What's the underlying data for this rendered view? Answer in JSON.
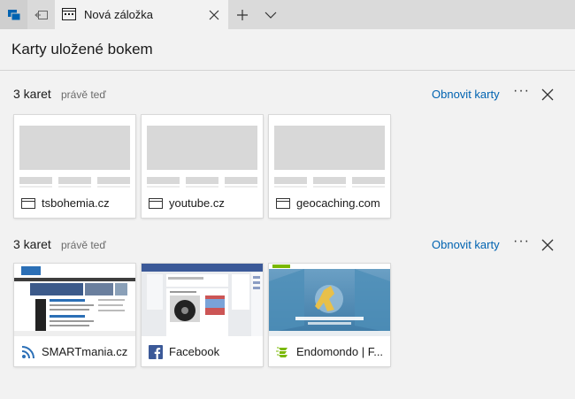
{
  "tab": {
    "title": "Nová záložka"
  },
  "pane": {
    "title": "Karty uložené bokem"
  },
  "groups": [
    {
      "count": "3 karet",
      "time": "právě teď",
      "restore_label": "Obnovit karty",
      "more_label": "···",
      "tabs": [
        {
          "label": "tsbohemia.cz"
        },
        {
          "label": "youtube.cz"
        },
        {
          "label": "geocaching.com"
        }
      ]
    },
    {
      "count": "3 karet",
      "time": "právě teď",
      "restore_label": "Obnovit karty",
      "more_label": "···",
      "tabs": [
        {
          "label": "SMARTmania.cz"
        },
        {
          "label": "Facebook"
        },
        {
          "label": "Endomondo | F..."
        }
      ]
    }
  ],
  "colors": {
    "accent": "#0063b1",
    "tab_strip": "#dadada",
    "facebook": "#3b5998",
    "rss": "#2b6fb6",
    "endomondo": "#7ab800"
  }
}
